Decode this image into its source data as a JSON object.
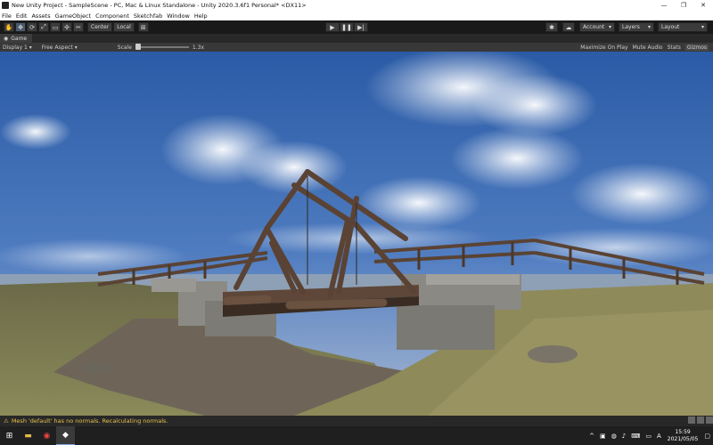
{
  "window": {
    "title": "New Unity Project - SampleScene - PC, Mac & Linux Standalone - Unity 2020.3.6f1 Personal* <DX11>",
    "minimize": "—",
    "maximize": "❐",
    "close": "✕"
  },
  "menu": [
    "File",
    "Edit",
    "Assets",
    "GameObject",
    "Component",
    "Sketchfab",
    "Window",
    "Help"
  ],
  "toolbar": {
    "pivot_label": "Center",
    "space_label": "Local",
    "account_label": "Account",
    "layers_label": "Layers",
    "layout_label": "Layout"
  },
  "game_tab": {
    "label": "Game",
    "display": "Display 1",
    "aspect": "Free Aspect",
    "scale_label": "Scale",
    "scale_value": "1.3x",
    "maximize_on_play": "Maximize On Play",
    "mute_audio": "Mute Audio",
    "stats": "Stats",
    "gizmos": "Gizmos"
  },
  "status": {
    "message": "Mesh 'default' has no normals. Recalculating normals."
  },
  "taskbar": {
    "time": "15:59",
    "date": "2021/05/05",
    "ime": "A"
  },
  "colors": {
    "sky_top": "#2f5fa8",
    "sky_bottom": "#9fb4d2",
    "grass": "#7a7a48",
    "wood": "#5a4334",
    "stone": "#8c8c8c",
    "warning": "#e7c14e"
  }
}
